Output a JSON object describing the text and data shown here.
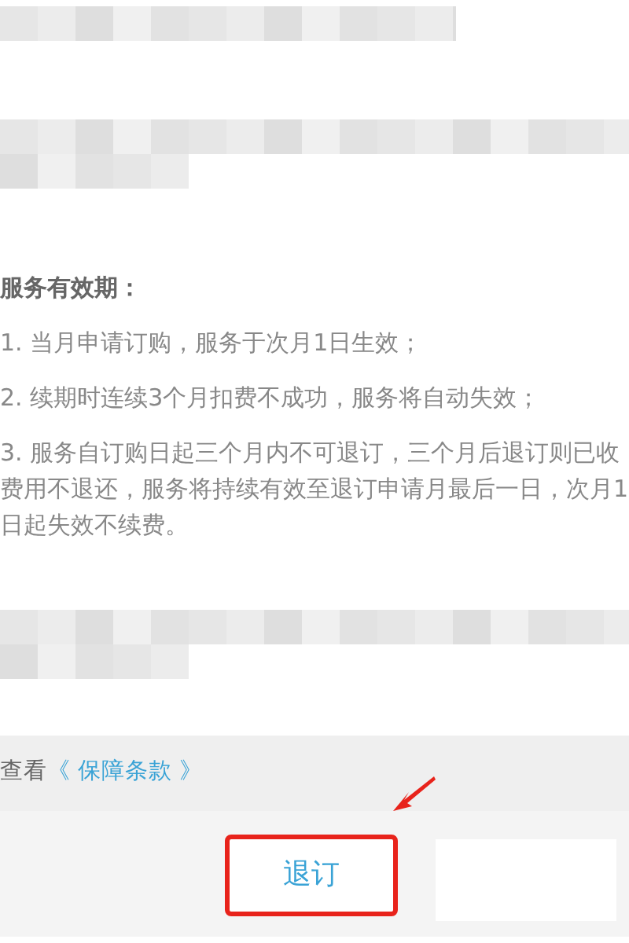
{
  "redactions": [
    {
      "kind": "pixelated-line"
    },
    {
      "kind": "pixelated-two-lines"
    },
    {
      "kind": "pixelated-two-lines"
    }
  ],
  "validity": {
    "title": "服务有效期：",
    "items": [
      "1. 当月申请订购，服务于次月1日生效；",
      "2. 续期时连续3个月扣费不成功，服务将自动失效；",
      "3. 服务自订购日起三个月内不可退订，三个月后退订则已收费用不退还，服务将持续有效至退订申请月最后一日，次月1日起失效不续费。"
    ]
  },
  "terms_bar": {
    "prefix": "查看",
    "link": "《 保障条款 》"
  },
  "footer": {
    "button": "退订",
    "highlighted": true
  }
}
